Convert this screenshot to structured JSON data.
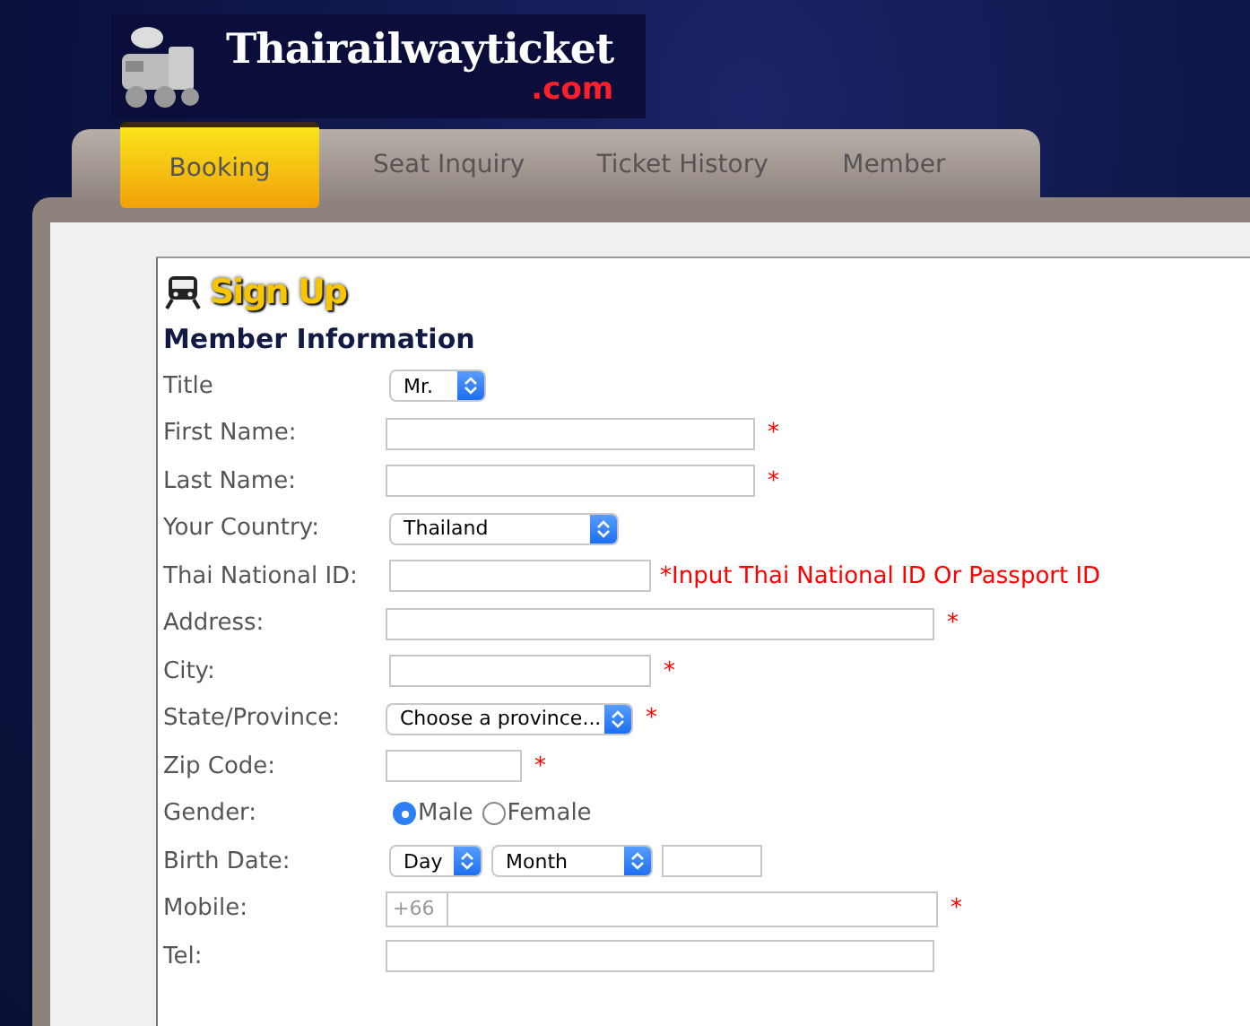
{
  "logo": {
    "name": "Thairailwayticket",
    "suffix": ".com"
  },
  "tabs": [
    {
      "label": "Booking",
      "selected": true
    },
    {
      "label": "Seat Inquiry",
      "selected": false
    },
    {
      "label": "Ticket History",
      "selected": false
    },
    {
      "label": "Member",
      "selected": false
    }
  ],
  "heading": "Sign Up",
  "section_title": "Member Information",
  "rows": [
    {
      "label": "Title",
      "kind": "select",
      "value": "Mr."
    },
    {
      "label": "First Name:",
      "kind": "text",
      "required_mark": "*"
    },
    {
      "label": "Last Name:",
      "kind": "text",
      "required_mark": "*"
    },
    {
      "label": "Your Country:",
      "kind": "select",
      "value": "Thailand"
    },
    {
      "label": "Thai National ID:",
      "kind": "text",
      "note": "*Input Thai National ID Or Passport ID"
    },
    {
      "label": "Address:",
      "kind": "text",
      "required_mark": "*"
    },
    {
      "label": "City:",
      "kind": "text",
      "required_mark": "*"
    },
    {
      "label": "State/Province:",
      "kind": "select",
      "value": "Choose a province...",
      "required_mark": "*"
    },
    {
      "label": "Zip Code:",
      "kind": "text",
      "required_mark": "*"
    },
    {
      "label": "Gender:",
      "kind": "radio",
      "options": [
        {
          "label": "Male",
          "selected": true
        },
        {
          "label": "Female",
          "selected": false
        }
      ]
    },
    {
      "label": "Birth Date:",
      "kind": "date",
      "day": "Day",
      "month": "Month"
    },
    {
      "label": "Mobile:",
      "kind": "phone",
      "prefix": "+66",
      "required_mark": "*"
    },
    {
      "label": "Tel:",
      "kind": "text"
    }
  ]
}
